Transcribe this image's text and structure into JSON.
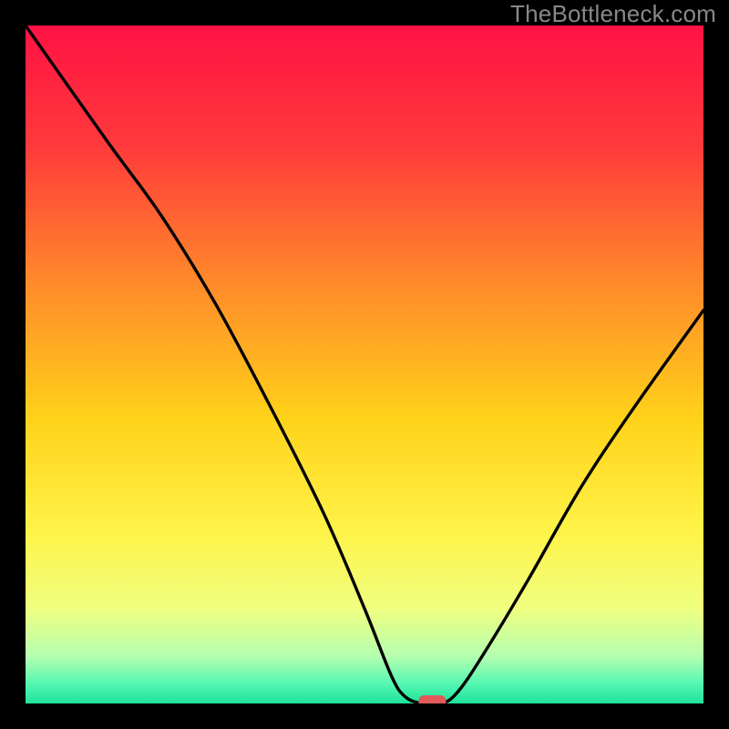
{
  "watermark": "TheBottleneck.com",
  "chart_data": {
    "type": "line",
    "title": "",
    "xlabel": "",
    "ylabel": "",
    "xlim": [
      0,
      100
    ],
    "ylim": [
      0,
      100
    ],
    "series": [
      {
        "name": "bottleneck-curve",
        "x": [
          0,
          12,
          20,
          28,
          36,
          44,
          50,
          54,
          56,
          58.5,
          61.5,
          64,
          68,
          74,
          82,
          90,
          100
        ],
        "values": [
          100,
          83,
          72,
          59,
          44,
          28,
          14,
          4,
          1,
          0,
          0,
          2,
          8,
          18,
          32,
          44,
          58
        ]
      }
    ],
    "marker": {
      "x": 60,
      "y": 0
    },
    "gradient_stops": [
      {
        "offset": 0,
        "color": "#ff1244"
      },
      {
        "offset": 0.18,
        "color": "#ff3b3b"
      },
      {
        "offset": 0.38,
        "color": "#ff8a2a"
      },
      {
        "offset": 0.58,
        "color": "#ffd21a"
      },
      {
        "offset": 0.75,
        "color": "#fff44a"
      },
      {
        "offset": 0.86,
        "color": "#efff80"
      },
      {
        "offset": 0.93,
        "color": "#b6ffb0"
      },
      {
        "offset": 0.97,
        "color": "#57f7b2"
      },
      {
        "offset": 1.0,
        "color": "#1fe29a"
      }
    ]
  }
}
